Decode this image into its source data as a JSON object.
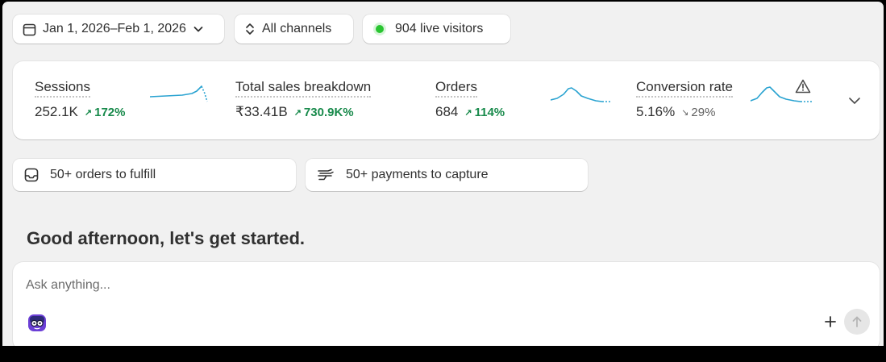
{
  "filters": {
    "date_range": "Jan 1, 2026–Feb 1, 2026",
    "channels": "All channels",
    "live_visitors": "904 live visitors"
  },
  "metrics": [
    {
      "title": "Sessions",
      "value": "252.1K",
      "delta": "172%",
      "direction": "up"
    },
    {
      "title": "Total sales breakdown",
      "value": "₹33.41B",
      "delta": "730.9K%",
      "direction": "up"
    },
    {
      "title": "Orders",
      "value": "684",
      "delta": "114%",
      "direction": "up"
    },
    {
      "title": "Conversion rate",
      "value": "5.16%",
      "delta": "29%",
      "direction": "down"
    }
  ],
  "tasks": {
    "orders": "50+ orders to fulfill",
    "payments": "50+ payments to capture"
  },
  "greeting": "Good afternoon, let's get started.",
  "chat": {
    "placeholder": "Ask anything..."
  },
  "colors": {
    "positive": "#188a4b",
    "sparkline": "#2aa3d1",
    "live": "#29c531"
  },
  "icons": [
    "calendar-icon",
    "chevron-down-icon",
    "sort-icon",
    "live-dot-icon",
    "warning-icon",
    "inbox-icon",
    "payment-icon",
    "avatar-icon",
    "plus-icon",
    "arrow-up-icon"
  ]
}
